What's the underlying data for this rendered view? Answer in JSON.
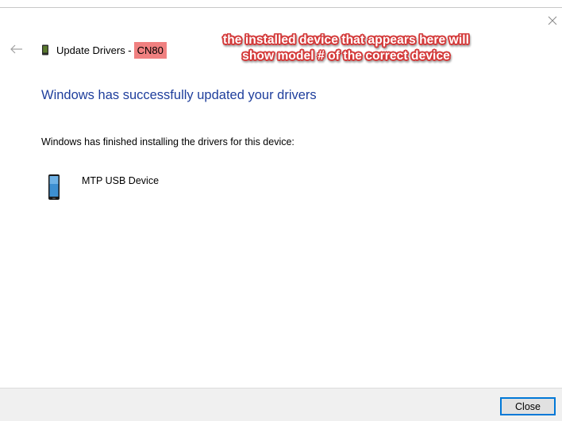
{
  "dialog": {
    "title_prefix": "Update Drivers - ",
    "device_model": "CN80",
    "heading": "Windows has successfully updated your drivers",
    "message": "Windows has finished installing the drivers for this device:",
    "device_name": "MTP USB Device",
    "close_label": "Close",
    "icons": {
      "close": "close-icon",
      "back": "back-arrow-icon",
      "device": "mobile-device-icon"
    },
    "colors": {
      "heading": "#1e3e9c",
      "highlight": "#f08080",
      "annotation": "#d43a3a",
      "button_border": "#0078d7"
    }
  },
  "annotation": {
    "line1": "the installed device that appears here will",
    "line2": "show model # of the correct device"
  }
}
